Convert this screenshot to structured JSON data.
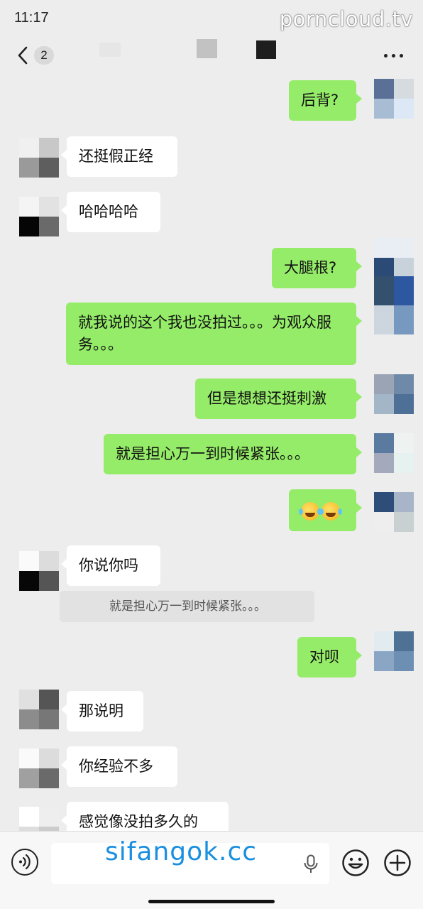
{
  "status_bar": {
    "time": "11:17",
    "watermark": "porncloud.tv"
  },
  "nav": {
    "back_badge": "2",
    "more_icon": "ellipsis-icon"
  },
  "messages": [
    {
      "side": "out",
      "text": "后背?"
    },
    {
      "side": "in",
      "text": "还挺假正经"
    },
    {
      "side": "in",
      "text": "哈哈哈哈"
    },
    {
      "side": "out",
      "text": "大腿根?"
    },
    {
      "side": "out",
      "text": "就我说的这个我也没拍过。。。为观众服务。。。"
    },
    {
      "side": "out",
      "text": "但是想想还挺刺激"
    },
    {
      "side": "out",
      "text": "就是担心万一到时候紧张。。。"
    },
    {
      "side": "out",
      "text": "",
      "emoji": "grin-sweat-emoji x2"
    },
    {
      "side": "in",
      "text": "你说你吗"
    },
    {
      "side": "out",
      "text": "对呗"
    },
    {
      "side": "in",
      "text": "那说明"
    },
    {
      "side": "in",
      "text": "你经验不多"
    },
    {
      "side": "in",
      "text": "感觉像没拍多久的"
    }
  ],
  "quote": {
    "text": "就是担心万一到时候紧张。。。"
  },
  "input_bar": {
    "watermark": "sifangok.cc",
    "placeholder": "",
    "icons": [
      "voice-icon",
      "mic-icon",
      "emoji-icon",
      "plus-icon"
    ]
  },
  "colors": {
    "background": "#ededed",
    "outgoing_bubble": "#95ec69",
    "incoming_bubble": "#ffffff",
    "watermark_bottom": "#1a8fe0"
  }
}
